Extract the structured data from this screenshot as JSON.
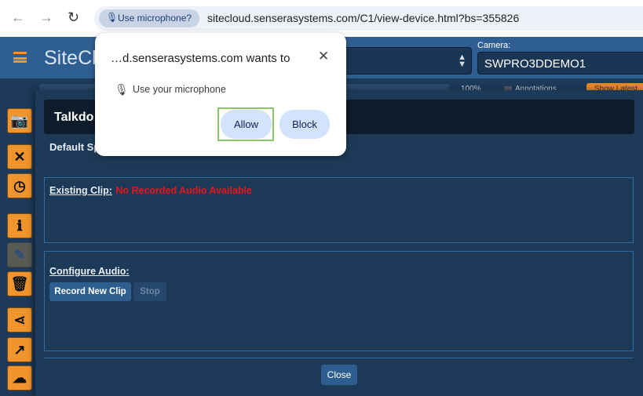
{
  "browser": {
    "mic_chip": "Use microphone?",
    "url": "sitecloud.senserasystems.com/C1/view-device.html?bs=355826"
  },
  "app": {
    "brand": "SiteClo",
    "camera_label": "Camera:",
    "camera_value": "SWPRO3DDEMO1",
    "zoom_pct": "100%",
    "annotations": "Annotations",
    "show_latest": "Show Latest"
  },
  "sidebar": {
    "icons": [
      "camera-icon",
      "tools-icon",
      "clock-icon",
      "info-icon",
      "pencil-icon",
      "trash-icon",
      "share-icon",
      "export-icon",
      "cloud-download-icon"
    ]
  },
  "modal": {
    "title": "Talkdo",
    "default_speaker": "Default Sp",
    "existing_label": "Existing Clip:",
    "existing_value": "No Recorded Audio Available",
    "configure_label": "Configure Audio:",
    "record": "Record New Clip",
    "stop": "Stop",
    "close": "Close"
  },
  "popup": {
    "title": "…d.senserasystems.com wants to",
    "permission": "Use your microphone",
    "allow": "Allow",
    "block": "Block"
  },
  "colors": {
    "accent": "#f0952e",
    "header": "#2f5f92",
    "error": "#e8141c",
    "allow_highlight": "#8bc46a"
  }
}
